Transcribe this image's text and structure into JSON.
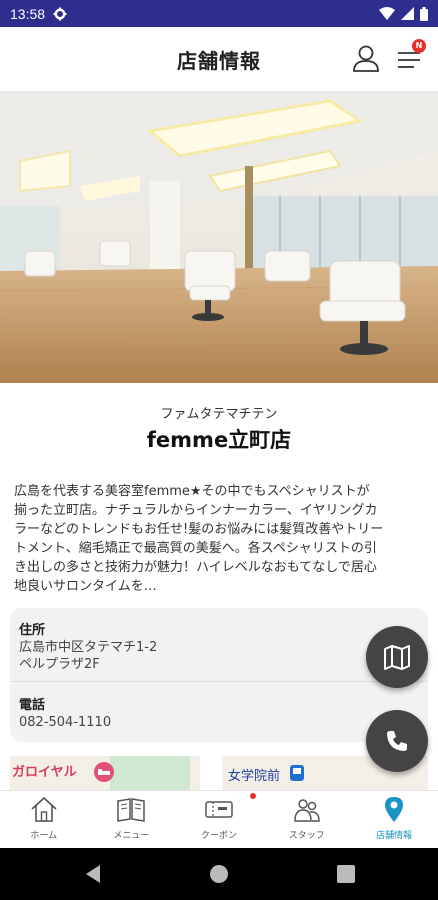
{
  "status_bar": {
    "time": "13:58"
  },
  "header": {
    "title": "店舗情報",
    "menu_badge": "N"
  },
  "store": {
    "kana": "ファムタテマチテン",
    "name": "femme立町店",
    "description_lines": [
      "広島を代表する美容室femme★その中でもスペシャリストが",
      "揃った立町店。ナチュラルからインナーカラー、イヤリングカ",
      "ラーなどのトレンドもお任せ!髪のお悩みには髪質改善やトリー",
      "トメント、縮毛矯正で最高質の美髪へ。各スペシャリストの引",
      "き出しの多さと技術力が魅力！ハイレベルなおもてなしで居心",
      "地良いサロンタイムを…"
    ]
  },
  "info": {
    "address_label": "住所",
    "address_line1": "広島市中区タテマチ1-2",
    "address_line2": "ペルプラザ2F",
    "phone_label": "電話",
    "phone": "082-504-1110"
  },
  "map": {
    "label_left": "ガロイヤル",
    "label_station": "女学院前"
  },
  "bottom_nav": [
    {
      "label": "ホーム",
      "icon": "home-icon"
    },
    {
      "label": "メニュー",
      "icon": "menu-book-icon"
    },
    {
      "label": "クーポン",
      "icon": "coupon-icon"
    },
    {
      "label": "スタッフ",
      "icon": "staff-icon"
    },
    {
      "label": "店舗情報",
      "icon": "location-pin-icon",
      "active": true
    }
  ],
  "colors": {
    "status_bar": "#2e2e8f",
    "accent": "#1a94c2",
    "badge": "#e53030",
    "fab": "#444444"
  }
}
